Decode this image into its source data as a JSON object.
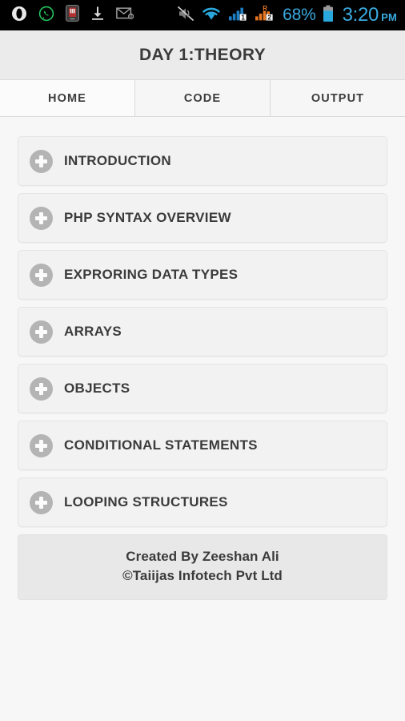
{
  "status_bar": {
    "left_icons": [
      {
        "name": "opera-browser-icon",
        "label": "Opera"
      },
      {
        "name": "whatsapp-icon",
        "label": "WhatsApp"
      },
      {
        "name": "app-notification-icon",
        "label": "App"
      },
      {
        "name": "download-icon",
        "label": "Download"
      },
      {
        "name": "email-icon",
        "label": "Email"
      }
    ],
    "right_icons": [
      {
        "name": "mute-icon",
        "label": "Silent mode"
      },
      {
        "name": "wifi-icon",
        "label": "Wi-Fi"
      },
      {
        "name": "signal-sim1-icon",
        "label": "Signal SIM 1"
      },
      {
        "name": "signal-sim2-roaming-icon",
        "label": "Signal SIM 2 roaming"
      }
    ],
    "roaming_badge": "R",
    "sim1_badge": "1",
    "sim2_badge": "2",
    "battery_percent": "68%",
    "battery_icon": "battery-icon",
    "clock_time": "3:20",
    "clock_ampm": "PM",
    "accent_color": "#3aabe0",
    "background_color": "#000000"
  },
  "header": {
    "title": "DAY 1:THEORY"
  },
  "tabs": [
    {
      "label": "HOME",
      "active": true
    },
    {
      "label": "CODE",
      "active": false
    },
    {
      "label": "OUTPUT",
      "active": false
    }
  ],
  "accordion": {
    "icon_name": "plus-circle-icon",
    "items": [
      {
        "label": "INTRODUCTION"
      },
      {
        "label": "PHP SYNTAX OVERVIEW"
      },
      {
        "label": "EXPRORING DATA TYPES"
      },
      {
        "label": "ARRAYS"
      },
      {
        "label": "OBJECTS"
      },
      {
        "label": "CONDITIONAL STATEMENTS"
      },
      {
        "label": "LOOPING STRUCTURES"
      }
    ]
  },
  "footer": {
    "line1": "Created By Zeeshan Ali",
    "line2": "©Taiijas Infotech Pvt Ltd"
  }
}
